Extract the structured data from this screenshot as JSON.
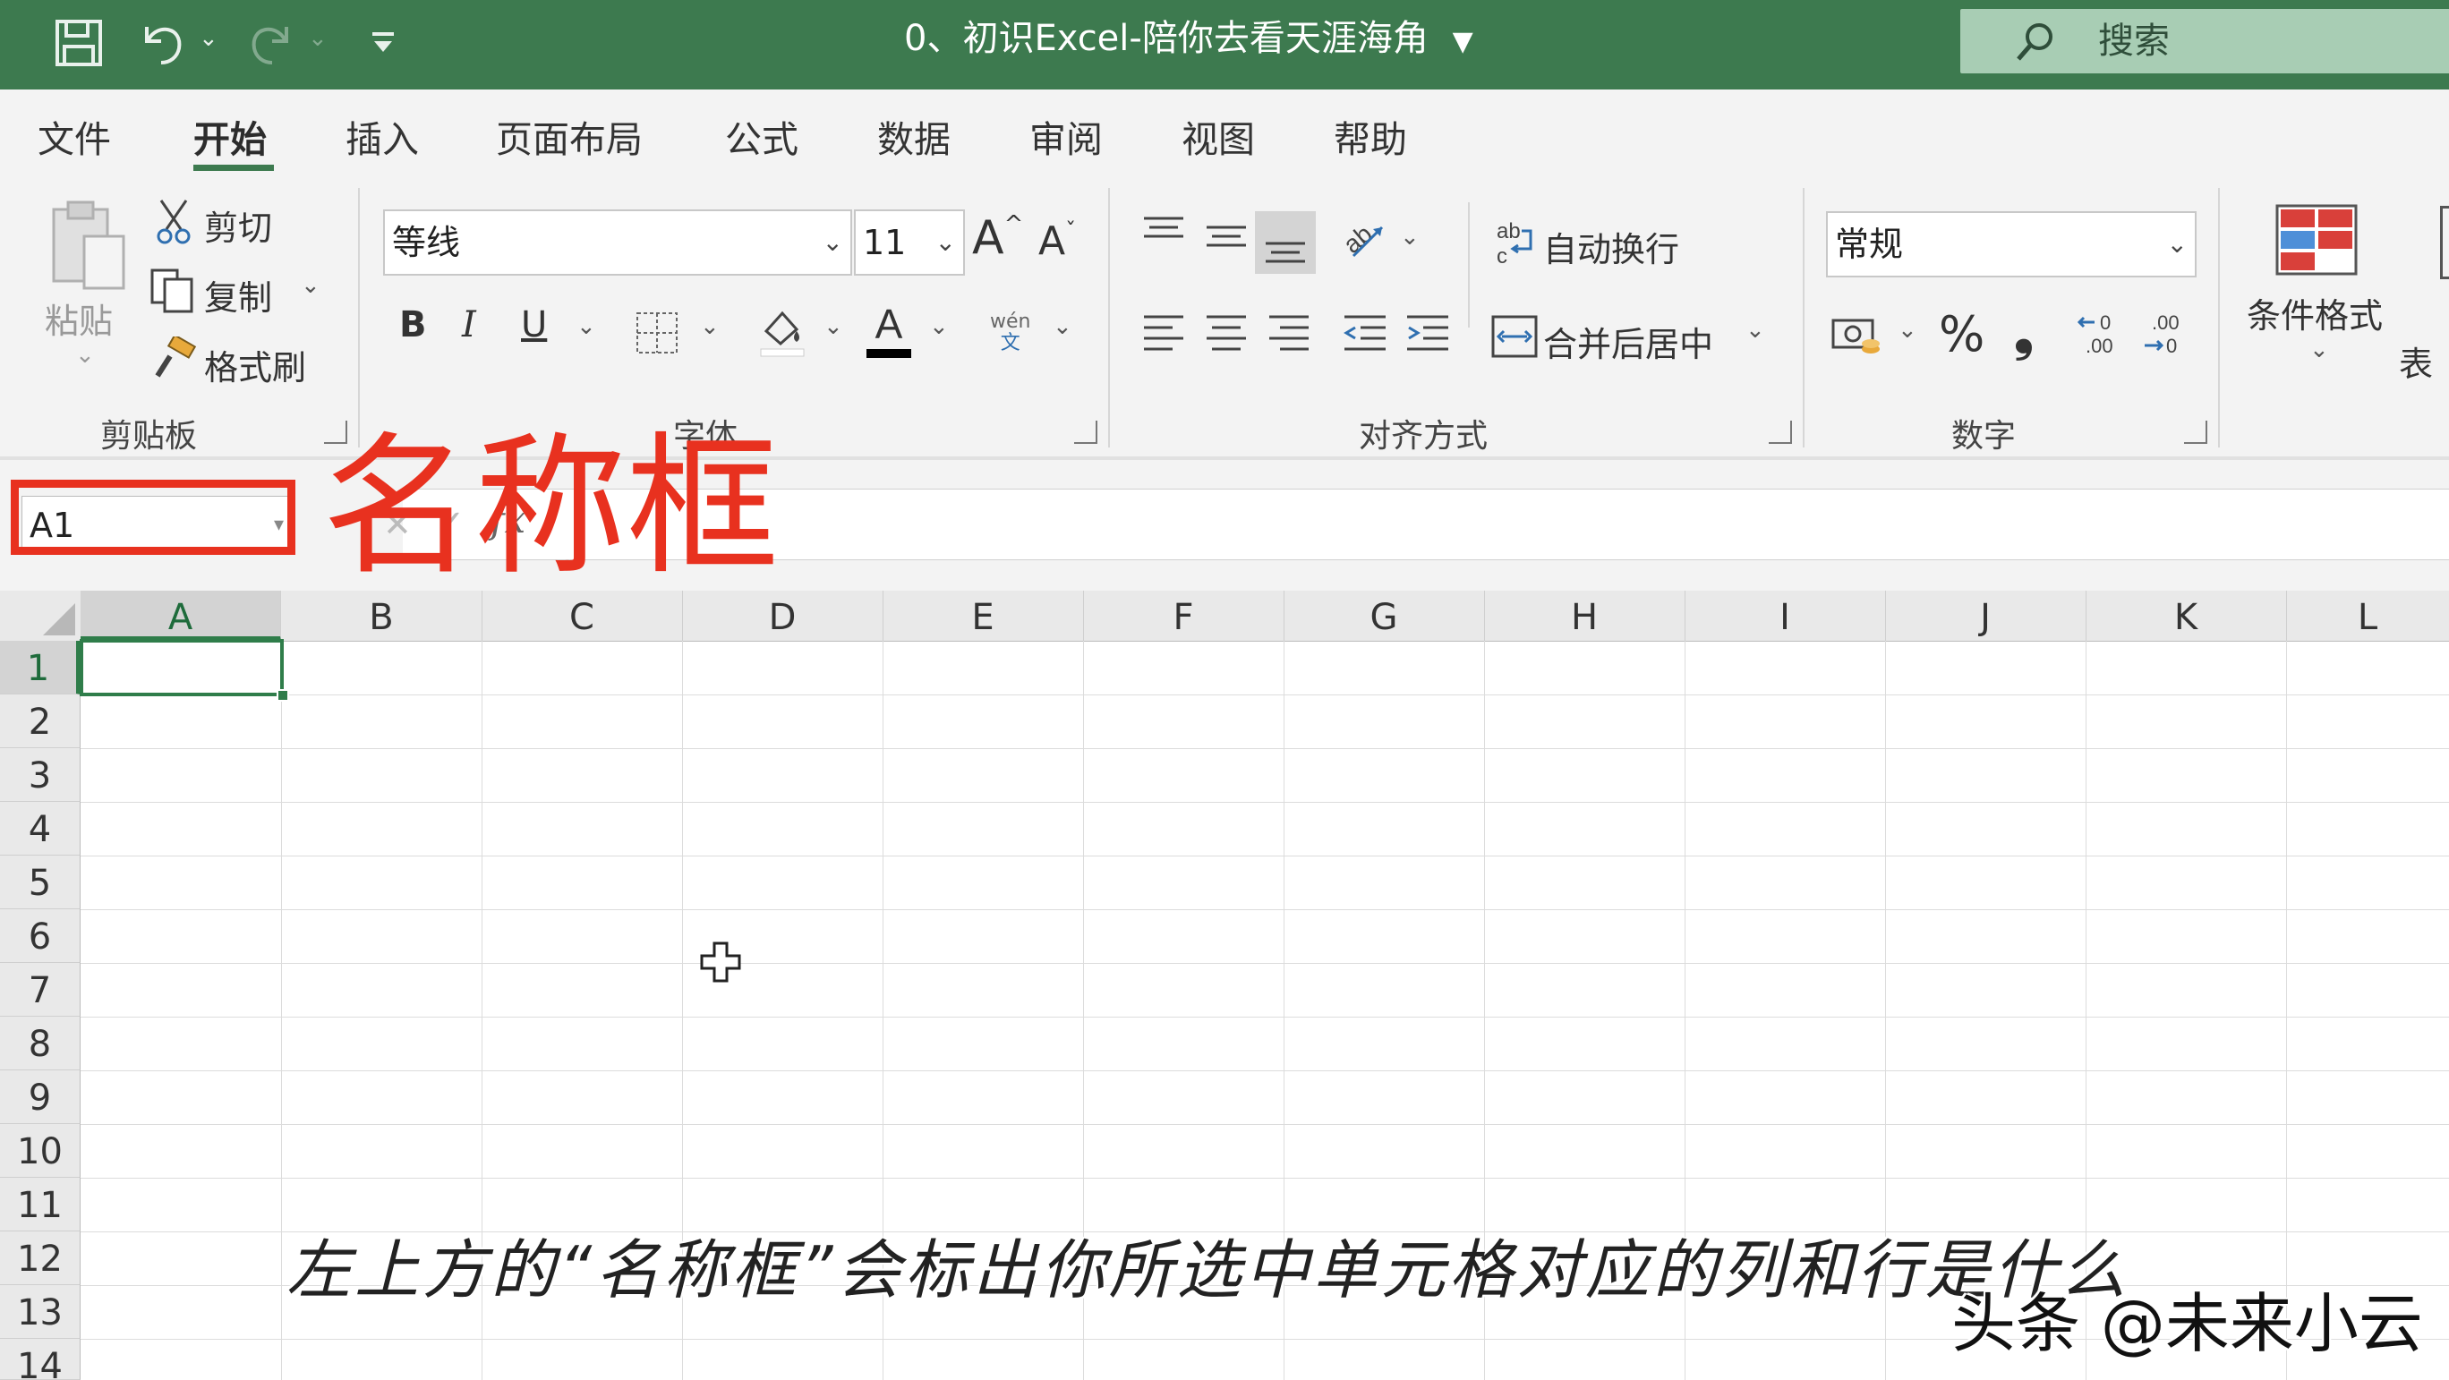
{
  "title_bar": {
    "document_title": "0、初识Excel-陪你去看天涯海角",
    "search_placeholder": "搜索",
    "icons": [
      "save-icon",
      "undo-icon",
      "redo-icon",
      "customize-qat-icon",
      "search-icon"
    ],
    "background_color": "#3d7a4f"
  },
  "ribbon_tabs": [
    {
      "label": "文件",
      "active": false
    },
    {
      "label": "开始",
      "active": true
    },
    {
      "label": "插入",
      "active": false
    },
    {
      "label": "页面布局",
      "active": false
    },
    {
      "label": "公式",
      "active": false
    },
    {
      "label": "数据",
      "active": false
    },
    {
      "label": "审阅",
      "active": false
    },
    {
      "label": "视图",
      "active": false
    },
    {
      "label": "帮助",
      "active": false
    }
  ],
  "clipboard": {
    "group_label": "剪贴板",
    "paste_label": "粘贴",
    "cut_label": "剪切",
    "copy_label": "复制",
    "format_painter_label": "格式刷"
  },
  "font": {
    "group_label": "字体",
    "font_name": "等线",
    "font_size": "11",
    "bold": "B",
    "italic": "I",
    "underline": "U",
    "phonetic_top": "wén",
    "phonetic_bottom": "文",
    "font_color": "#000000"
  },
  "alignment": {
    "group_label": "对齐方式",
    "wrap_text_label": "自动换行",
    "merge_center_label": "合并后居中"
  },
  "number": {
    "group_label": "数字",
    "format": "常规",
    "percent": "%",
    "comma": "❟"
  },
  "styles": {
    "conditional_format_label": "条件格式",
    "table_format_label_partial": "表"
  },
  "formula_bar": {
    "name_box_value": "A1",
    "annotation_text": "名称框",
    "highlight_color": "#e8311f"
  },
  "grid": {
    "columns": [
      "A",
      "B",
      "C",
      "D",
      "E",
      "F",
      "G",
      "H",
      "I",
      "J",
      "K",
      "L"
    ],
    "rows": [
      "1",
      "2",
      "3",
      "4",
      "5",
      "6",
      "7",
      "8",
      "9",
      "10",
      "11",
      "12",
      "13",
      "14"
    ],
    "selected_cell": "A1"
  },
  "subtitle": "左上方的“名称框”会标出你所选中单元格对应的列和行是什么",
  "watermark": "头条 @未来小云"
}
